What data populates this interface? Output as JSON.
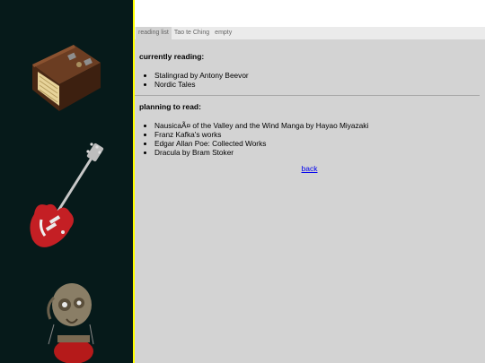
{
  "tabs": [
    {
      "label": "reading list",
      "active": true
    },
    {
      "label": "Tao te Ching",
      "active": false
    },
    {
      "label": "empty",
      "active": false
    }
  ],
  "currently_reading": {
    "title": "currently reading:",
    "items": [
      "Stalingrad by Antony Beevor",
      "Nordic Tales"
    ]
  },
  "planning": {
    "title": "planning to read:",
    "items": [
      "NausicaÃ¤ of the Valley and the Wind Manga by Hayao Miyazaki",
      "Franz Kafka's works",
      "Edgar Allan Poe: Collected Works",
      "Dracula by Bram Stoker"
    ]
  },
  "back_link": "back",
  "colors": {
    "sidebar_bg": "#061a1a",
    "sidebar_edge": "#ffff00",
    "content_bg": "#d3d3d3",
    "tab_bar_bg": "#ebebeb",
    "link": "#0000ee"
  },
  "sidebar_images": [
    "book-icon",
    "guitar-icon",
    "robot-figure-icon"
  ]
}
